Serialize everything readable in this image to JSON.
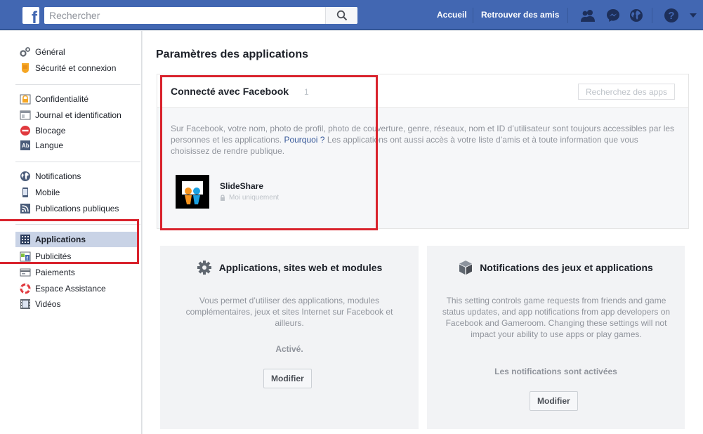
{
  "colors": {
    "topbar": "#4267b2",
    "accent_red": "#d9232d",
    "link": "#365899",
    "active_item": "#c9d3e6"
  },
  "topbar": {
    "logo": "f",
    "search_placeholder": "Rechercher",
    "search_icon": "magnifier-icon",
    "links": [
      "Accueil",
      "Retrouver des amis"
    ],
    "icons": [
      "friend-requests-icon",
      "messenger-icon",
      "notifications-globe-icon",
      "help-icon",
      "caret-down-icon"
    ]
  },
  "sidebar": {
    "groups": [
      {
        "items": [
          {
            "label": "Général",
            "icon": "gears-icon"
          },
          {
            "label": "Sécurité et connexion",
            "icon": "shield-badge-icon"
          }
        ]
      },
      {
        "items": [
          {
            "label": "Confidentialité",
            "icon": "lock-icon"
          },
          {
            "label": "Journal et identification",
            "icon": "timeline-icon"
          },
          {
            "label": "Blocage",
            "icon": "block-icon"
          },
          {
            "label": "Langue",
            "icon": "language-icon"
          }
        ]
      },
      {
        "items": [
          {
            "label": "Notifications",
            "icon": "globe-icon"
          },
          {
            "label": "Mobile",
            "icon": "mobile-icon"
          },
          {
            "label": "Publications publiques",
            "icon": "rss-icon"
          }
        ]
      },
      {
        "items": [
          {
            "label": "Applications",
            "icon": "apps-grid-icon",
            "active": true
          },
          {
            "label": "Publicités",
            "icon": "ads-icon"
          },
          {
            "label": "Paiements",
            "icon": "credit-card-icon"
          },
          {
            "label": "Espace Assistance",
            "icon": "lifebuoy-icon"
          },
          {
            "label": "Vidéos",
            "icon": "film-icon"
          }
        ]
      }
    ]
  },
  "main": {
    "title": "Paramètres des applications",
    "connected": {
      "title": "Connecté avec Facebook",
      "count": "1",
      "search_button": "Recherchez des apps",
      "desc_before": "Sur Facebook, votre nom, photo de profil, photo de couverture, genre, réseaux, nom et ID d’utilisateur sont toujours accessibles par les personnes et les applications. ",
      "desc_link": "Pourquoi ?",
      "desc_after": " Les applications ont aussi accès à votre liste d’amis et à toute information que vous choisissez de rendre publique.",
      "apps": [
        {
          "name": "SlideShare",
          "privacy": "Moi uniquement",
          "icon": "slideshare-logo-icon"
        }
      ]
    },
    "cards": [
      {
        "icon": "gear-icon",
        "title": "Applications, sites web et modules",
        "desc": "Vous permet d’utiliser des applications, modules complémentaires, jeux et sites Internet sur Facebook et ailleurs.",
        "status": "Activé.",
        "button": "Modifier"
      },
      {
        "icon": "cube-icon",
        "title": "Notifications des jeux et applications",
        "desc": "This setting controls game requests from friends and game status updates, and app notifications from app developers on Facebook and Gameroom. Changing these settings will not impact your ability to use apps or play games.",
        "status": "Les notifications sont activées",
        "button": "Modifier"
      }
    ]
  }
}
